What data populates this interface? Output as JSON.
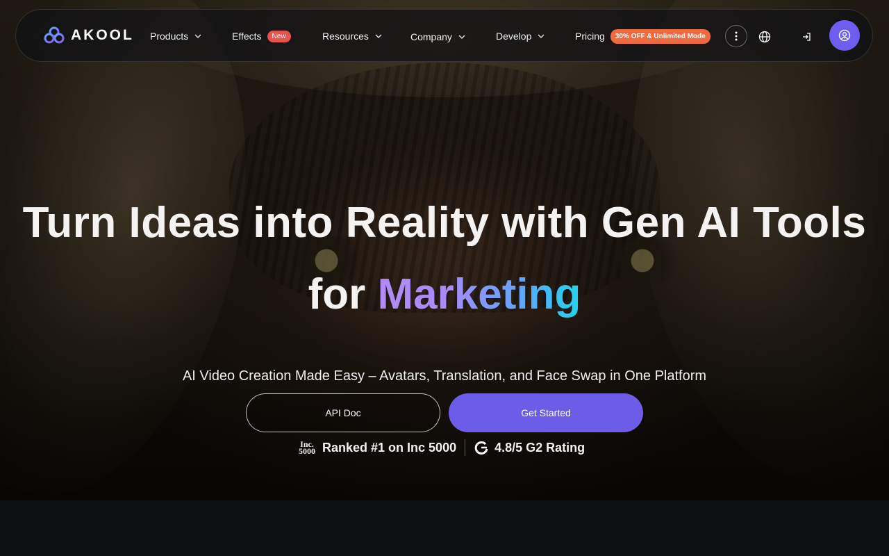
{
  "brand": {
    "name": "AKOOL",
    "accent": "#6c5ce7"
  },
  "nav": {
    "items": [
      {
        "label": "Products",
        "has_dropdown": true
      },
      {
        "label": "Effects",
        "badge": "New"
      },
      {
        "label": "Resources",
        "has_dropdown": true
      },
      {
        "label": "Company",
        "has_dropdown": true
      },
      {
        "label": "Develop",
        "has_dropdown": true
      },
      {
        "label": "Pricing",
        "badge": "30% OFF & Unlimited Mode"
      }
    ],
    "icons": [
      "more-vertical-icon",
      "globe-icon",
      "login-icon",
      "user-circle-icon"
    ]
  },
  "hero": {
    "headline_line1": "Turn Ideas into Reality with Gen AI Tools",
    "headline_line2_prefix": "for ",
    "headline_line2_highlight": "Marketing",
    "subtitle": "AI Video Creation Made Easy – Avatars, Translation, and Face Swap in One Platform",
    "buttons": {
      "api_doc": "API Doc",
      "get_started": "Get Started"
    },
    "inc_logo": {
      "line1": "Inc.",
      "line2": "5000"
    },
    "rank_text": "Ranked #1 on Inc 5000",
    "g2_text": "4.8/5 G2 Rating"
  }
}
